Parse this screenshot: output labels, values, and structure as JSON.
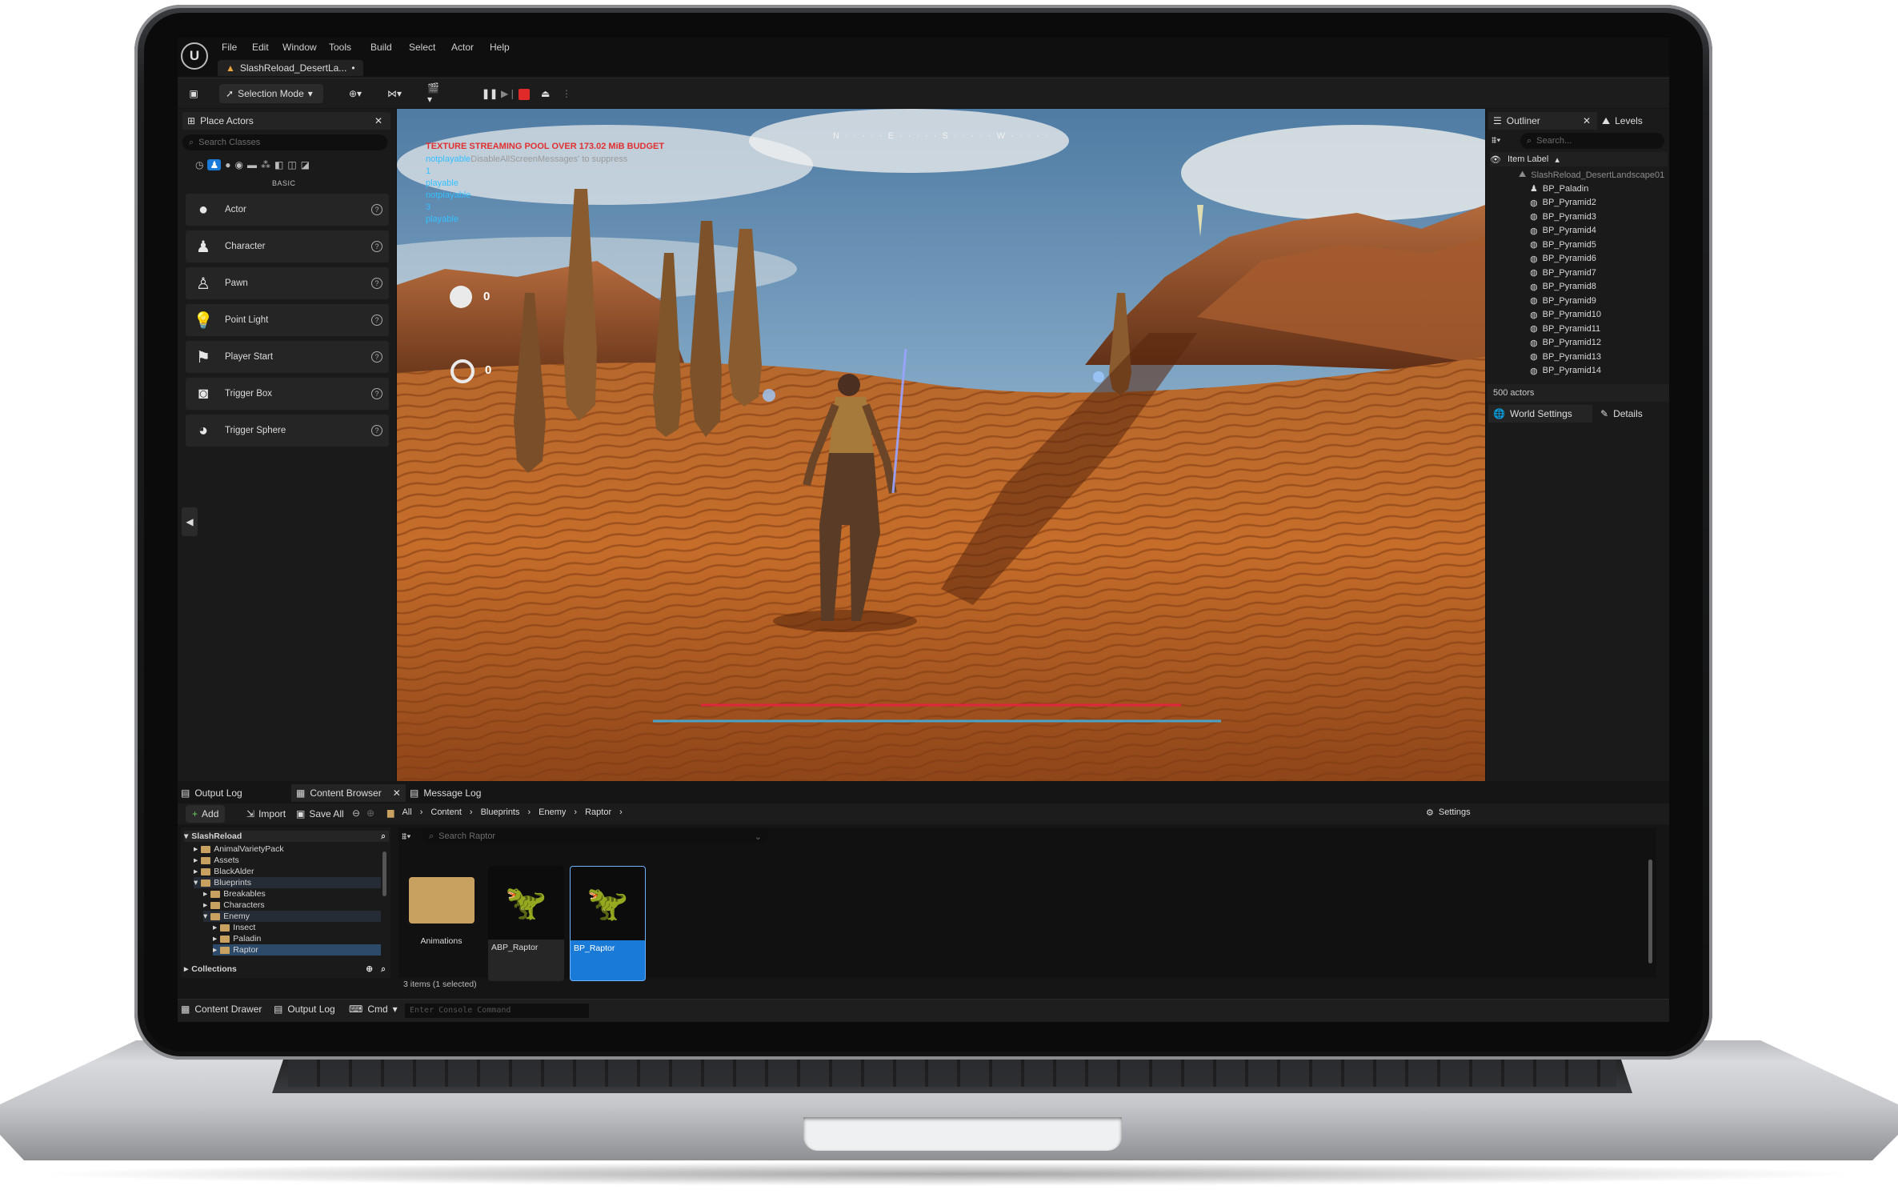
{
  "window": {
    "tab_title": "SlashReload_DesertLa...",
    "tab_dirty_marker": "•"
  },
  "menu": [
    "File",
    "Edit",
    "Window",
    "Tools",
    "Build",
    "Select",
    "Actor",
    "Help"
  ],
  "toolbar": {
    "selection_mode": "Selection Mode"
  },
  "place_actors": {
    "tab": "Place Actors",
    "search_placeholder": "Search Classes",
    "section": "BASIC",
    "items": [
      {
        "label": "Actor",
        "icon": "sphere-icon"
      },
      {
        "label": "Character",
        "icon": "character-icon"
      },
      {
        "label": "Pawn",
        "icon": "pawn-icon"
      },
      {
        "label": "Point Light",
        "icon": "lightbulb-icon"
      },
      {
        "label": "Player Start",
        "icon": "player-start-flag-icon"
      },
      {
        "label": "Trigger Box",
        "icon": "cube-icon"
      },
      {
        "label": "Trigger Sphere",
        "icon": "sphere-icon"
      }
    ]
  },
  "viewport": {
    "warning": "TEXTURE STREAMING POOL OVER 173.02 MiB BUDGET",
    "debug_line1_a": "notplayable",
    "debug_line1_b": "DisableAllScreenMessages' to suppress",
    "debug_lines": [
      "1",
      "playable",
      "notplayable",
      "3",
      "playable"
    ],
    "hud_counter1": "0",
    "hud_counter2": "0",
    "compass": "N · · · · · E · · · · · S · · · · · W · · · · ·",
    "health_fraction": 0.78,
    "stamina_fraction": 1.0
  },
  "outliner": {
    "tab": "Outliner",
    "levels_tab": "Levels",
    "search_placeholder": "Search...",
    "column": "Item Label",
    "root": "SlashReload_DesertLandscape01",
    "items": [
      "BP_Paladin",
      "BP_Pyramid2",
      "BP_Pyramid3",
      "BP_Pyramid4",
      "BP_Pyramid5",
      "BP_Pyramid6",
      "BP_Pyramid7",
      "BP_Pyramid8",
      "BP_Pyramid9",
      "BP_Pyramid10",
      "BP_Pyramid11",
      "BP_Pyramid12",
      "BP_Pyramid13",
      "BP_Pyramid14"
    ],
    "count": "500 actors",
    "world_settings": "World Settings",
    "details": "Details"
  },
  "bottom_tabs": {
    "output_log": "Output Log",
    "content_browser": "Content Browser",
    "message_log": "Message Log"
  },
  "content_browser": {
    "add": "Add",
    "import": "Import",
    "save_all": "Save All",
    "breadcrumb": [
      "All",
      "Content",
      "Blueprints",
      "Enemy",
      "Raptor"
    ],
    "settings": "Settings",
    "tree_root": "SlashReload",
    "tree": [
      {
        "label": "AnimalVarietyPack",
        "indent": 1
      },
      {
        "label": "Assets",
        "indent": 1
      },
      {
        "label": "BlackAlder",
        "indent": 1
      },
      {
        "label": "Blueprints",
        "indent": 1
      },
      {
        "label": "Breakables",
        "indent": 2
      },
      {
        "label": "Characters",
        "indent": 2
      },
      {
        "label": "Enemy",
        "indent": 2
      },
      {
        "label": "Insect",
        "indent": 3
      },
      {
        "label": "Paladin",
        "indent": 3
      },
      {
        "label": "Raptor",
        "indent": 3
      }
    ],
    "collections": "Collections",
    "search_placeholder": "Search Raptor",
    "assets": [
      {
        "label": "Animations",
        "type": "folder"
      },
      {
        "label": "ABP_Raptor",
        "type": "anim-blueprint"
      },
      {
        "label": "BP_Raptor",
        "type": "blueprint",
        "selected": true
      }
    ],
    "status": "3 items (1 selected)"
  },
  "statusbar": {
    "content_drawer": "Content Drawer",
    "output_log": "Output Log",
    "cmd": "Cmd",
    "console_placeholder": "Enter Console Command"
  },
  "colors": {
    "accent": "#1a7ad8",
    "warning": "#e03030",
    "debug_cyan": "#35c0ff",
    "health": "#e0263c",
    "stamina": "#4aa3c7"
  }
}
